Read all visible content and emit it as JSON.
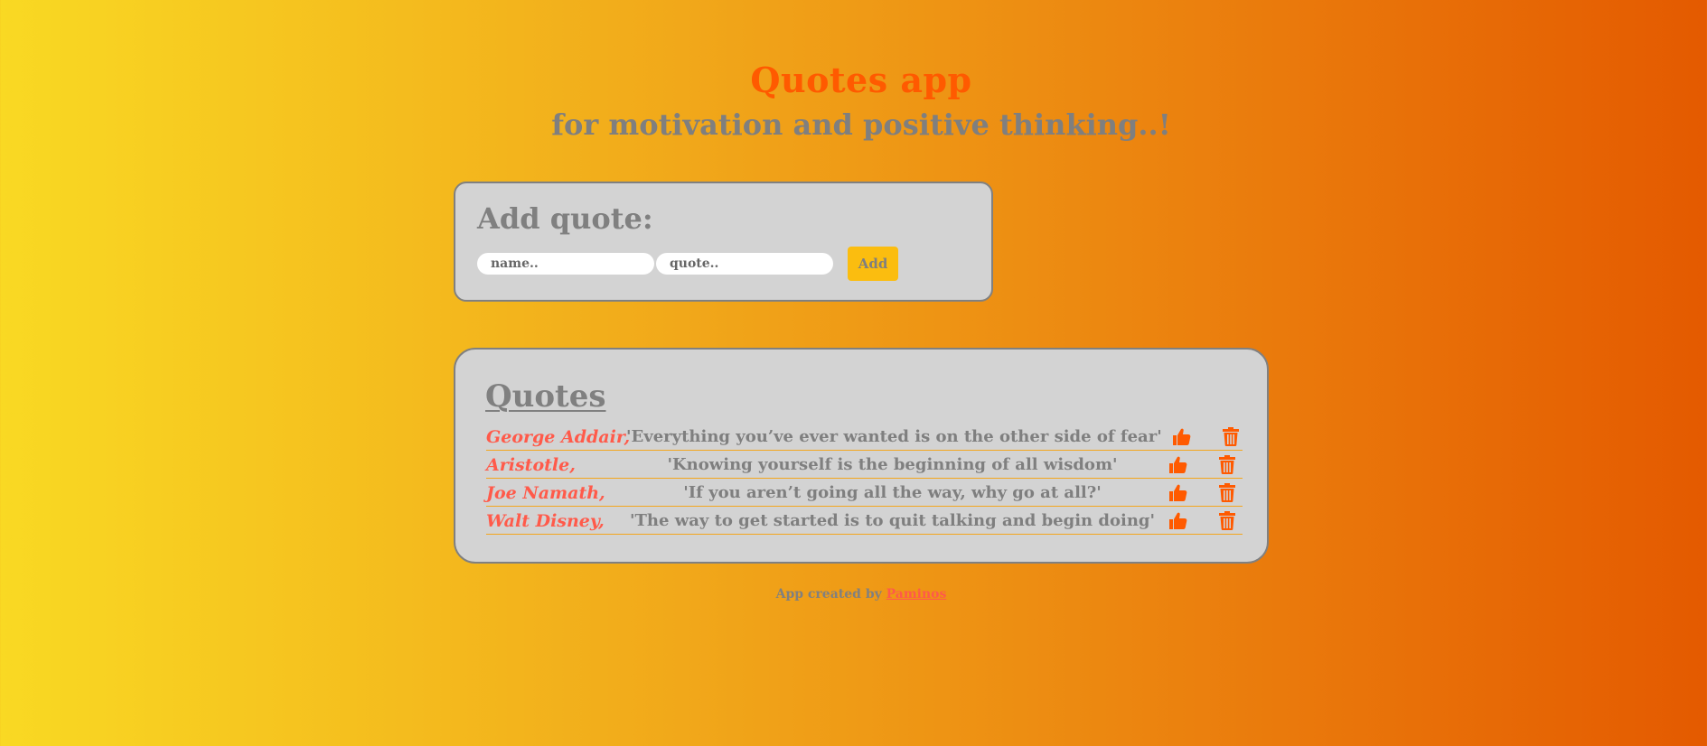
{
  "header": {
    "title": "Quotes app",
    "subtitle": "for motivation and positive thinking..!"
  },
  "add_form": {
    "title": "Add quote:",
    "name_placeholder": "name..",
    "quote_placeholder": "quote..",
    "add_label": "Add"
  },
  "quotes": {
    "title": "Quotes",
    "items": [
      {
        "author": "George Addair,",
        "text": "'Everything you’ve ever wanted is on the other side of fear'"
      },
      {
        "author": "Aristotle,",
        "text": "'Knowing yourself is the beginning of all wisdom'"
      },
      {
        "author": "Joe Namath,",
        "text": "'If you aren’t going all the way, why go at all?'"
      },
      {
        "author": "Walt Disney,",
        "text": "'The way to get started is to quit talking and begin doing'"
      }
    ],
    "like_icon": "thumbs-up-icon",
    "delete_icon": "trash-icon"
  },
  "footer": {
    "text": "App created by ",
    "link_text": "Paminos"
  },
  "colors": {
    "accent": "#ff5a00",
    "author": "#ff5a4a",
    "text_gray": "#808080",
    "card_bg": "#d3d3d3",
    "button": "#fbbd0f"
  }
}
